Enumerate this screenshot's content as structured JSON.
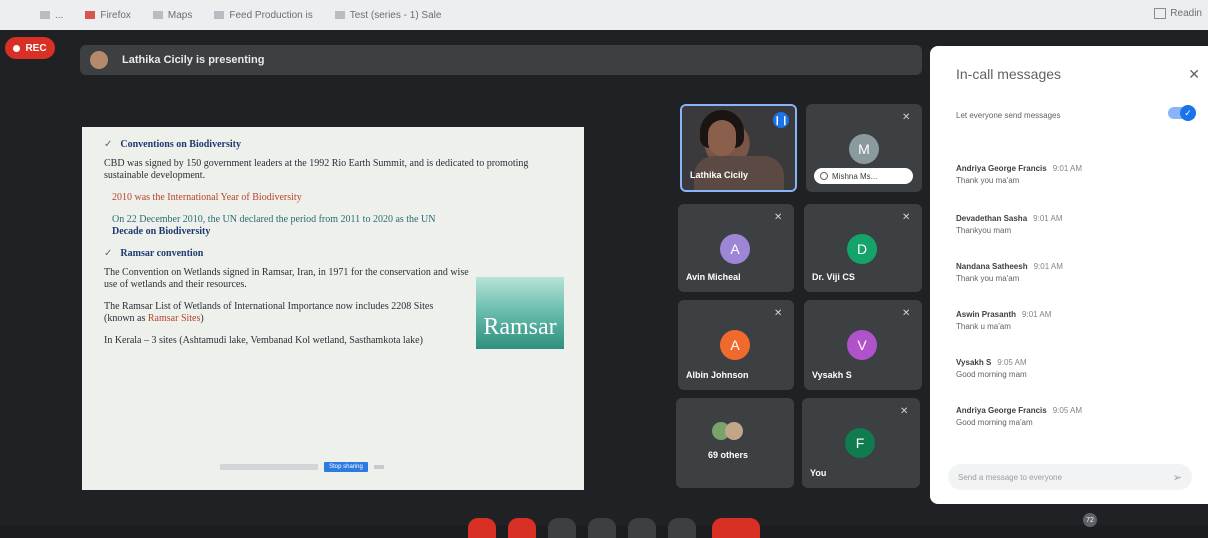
{
  "bookmarks": [
    {
      "label": "..."
    },
    {
      "label": "Firefox"
    },
    {
      "label": "Maps"
    },
    {
      "label": "Feed Production is"
    },
    {
      "label": "Test (series - 1) Sale"
    }
  ],
  "reading_list": "Readin",
  "recording": {
    "label": "REC"
  },
  "presenter_bar": {
    "text": "Lathika Cicily is presenting"
  },
  "slide": {
    "section1": "Conventions on Biodiversity",
    "p1": "CBD was signed by 150 government leaders at the 1992 Rio Earth Summit, and is dedicated to promoting sustainable development.",
    "p2": "2010 was the International Year of Biodiversity",
    "p3_text": "On 22 December 2010, the UN declared the period from 2011 to 2020 as the UN",
    "p3_bold": "Decade on Biodiversity",
    "section2": "Ramsar convention",
    "p4": "The Convention on Wetlands signed in Ramsar, Iran, in 1971 for the conservation and wise use of wetlands and their resources.",
    "p5a": "The Ramsar List of Wetlands of International Importance now includes 2208 Sites (known as ",
    "p5b": "Ramsar Sites",
    "p5c": ")",
    "p6": "In Kerala – 3 sites (Ashtamudi lake, Vembanad Kol wetland, Sasthamkota lake)",
    "logo_text": "Ramsar",
    "toolbar_button": "Stop sharing"
  },
  "participants": [
    {
      "name": "Lathika Cicily",
      "type": "video"
    },
    {
      "name": "Mishna Ms...",
      "initial": "M",
      "color": "#8a9a9e"
    },
    {
      "name": "Avin Micheal",
      "initial": "A",
      "color": "#9e86d6"
    },
    {
      "name": "Dr. Viji CS",
      "initial": "D",
      "color": "#14a36b"
    },
    {
      "name": "Albin Johnson",
      "initial": "A",
      "color": "#f06a2d"
    },
    {
      "name": "Vysakh S",
      "initial": "V",
      "color": "#b052c9"
    },
    {
      "name": "69 others"
    },
    {
      "name": "You",
      "initial": "F",
      "color": "#0f7b4f"
    }
  ],
  "chat": {
    "title": "In-call messages",
    "toggle_label": "Let everyone send messages",
    "messages": [
      {
        "sender": "Andriya George Francis",
        "time": "9:01 AM",
        "text": "Thank you ma'am"
      },
      {
        "sender": "Devadethan Sasha",
        "time": "9:01 AM",
        "text": "Thankyou mam"
      },
      {
        "sender": "Nandana Satheesh",
        "time": "9:01 AM",
        "text": "Thank you ma'am"
      },
      {
        "sender": "Aswin Prasanth",
        "time": "9:01 AM",
        "text": "Thank u ma'am"
      },
      {
        "sender": "Vysakh S",
        "time": "9:05 AM",
        "text": "Good morning mam"
      },
      {
        "sender": "Andriya George Francis",
        "time": "9:05 AM",
        "text": "Good morning ma'am"
      }
    ],
    "input_placeholder": "Send a message to everyone"
  },
  "controls_badge": "72",
  "colors": {
    "rec": "#d93025",
    "accent": "#1a73e8",
    "tile": "#3c4043",
    "background": "#202124"
  }
}
